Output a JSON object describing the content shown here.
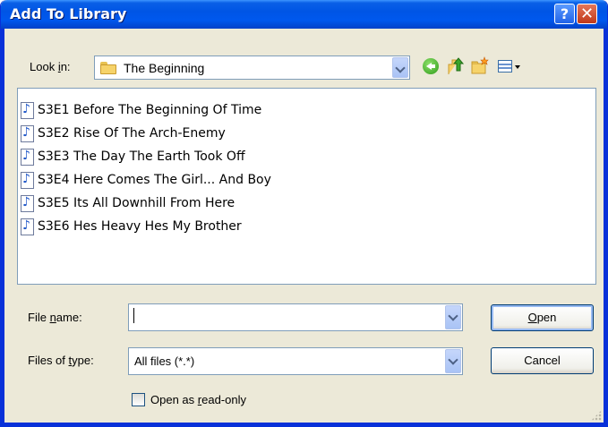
{
  "window": {
    "title": "Add To Library",
    "help_label": "?",
    "close_label": "✕"
  },
  "look_in": {
    "label_pre": "Look ",
    "label_accel": "i",
    "label_post": "n:",
    "value": "The Beginning",
    "folder_icon": "folder-icon"
  },
  "toolbar": {
    "icons": [
      "back-icon",
      "up-one-level-icon",
      "new-folder-icon",
      "views-menu-icon"
    ],
    "colors": {
      "back": "#2f9c1a",
      "folder": "#f6d36a"
    }
  },
  "files": [
    "S3E1 Before The Beginning Of Time",
    "S3E2 Rise Of The Arch-Enemy",
    "S3E3 The Day The Earth Took Off",
    "S3E4 Here Comes The Girl... And Boy",
    "S3E5 Its All Downhill From Here",
    "S3E6 Hes Heavy Hes My Brother"
  ],
  "file_name": {
    "label_pre": "File ",
    "label_accel": "n",
    "label_post": "ame:",
    "value": ""
  },
  "file_type": {
    "label_pre": "Files of ",
    "label_accel": "t",
    "label_post": "ype:",
    "value": "All files (*.*)"
  },
  "buttons": {
    "open_accel": "O",
    "open_rest": "pen",
    "cancel": "Cancel"
  },
  "read_only": {
    "label_pre": "Open as ",
    "label_accel": "r",
    "label_post": "ead-only",
    "checked": false
  }
}
